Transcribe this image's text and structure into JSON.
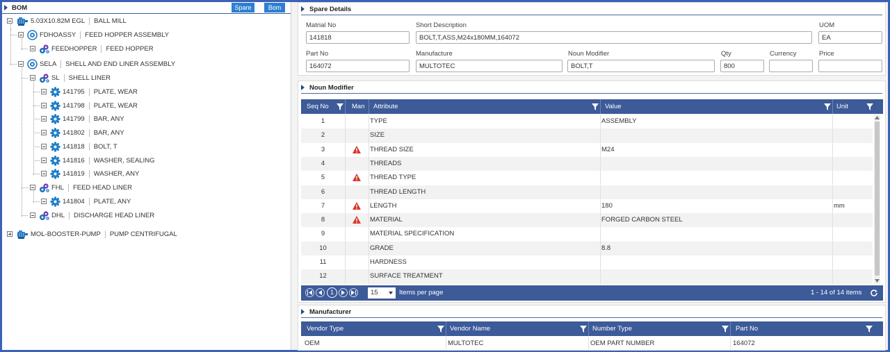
{
  "bom": {
    "title": "BOM",
    "spare_button": "Spare",
    "bom_button": "Bom",
    "nodes": [
      {
        "code": "5.03X10.82M EGL",
        "desc": "BALL MILL",
        "icon": "motor-icon"
      },
      {
        "code": "FDHOASSY",
        "desc": "FEED HOPPER ASSEMBLY",
        "icon": "assembly-icon"
      },
      {
        "code": "FEEDHOPPER",
        "desc": "FEED HOPPER",
        "icon": "gears-icon"
      },
      {
        "code": "SELA",
        "desc": "SHELL AND END LINER ASSEMBLY",
        "icon": "assembly-icon"
      },
      {
        "code": "SL",
        "desc": "SHELL LINER",
        "icon": "gears-icon"
      },
      {
        "code": "141795",
        "desc": "PLATE, WEAR",
        "icon": "gear-icon"
      },
      {
        "code": "141798",
        "desc": "PLATE, WEAR",
        "icon": "gear-icon"
      },
      {
        "code": "141799",
        "desc": "BAR, ANY",
        "icon": "gear-icon"
      },
      {
        "code": "141802",
        "desc": "BAR, ANY",
        "icon": "gear-icon"
      },
      {
        "code": "141818",
        "desc": "BOLT, T",
        "icon": "gear-icon"
      },
      {
        "code": "141816",
        "desc": "WASHER, SEALING",
        "icon": "gear-icon"
      },
      {
        "code": "141819",
        "desc": "WASHER, ANY",
        "icon": "gear-icon"
      },
      {
        "code": "FHL",
        "desc": "FEED HEAD LINER",
        "icon": "gears-icon"
      },
      {
        "code": "141804",
        "desc": "PLATE, ANY",
        "icon": "gear-icon"
      },
      {
        "code": "DHL",
        "desc": "DISCHARGE HEAD LINER",
        "icon": "gears-icon"
      },
      {
        "code": "MOL-BOOSTER-PUMP",
        "desc": "PUMP CENTRIFUGAL",
        "icon": "motor-icon"
      }
    ]
  },
  "spare": {
    "title": "Spare Details",
    "material_no_label": "Matrial No",
    "material_no": "141818",
    "short_desc_label": "Short Description",
    "short_desc": "BOLT,T,ASS,M24x180MM,164072",
    "uom_label": "UOM",
    "uom": "EA",
    "part_no_label": "Part No",
    "part_no": "164072",
    "manufacture_label": "Manufacture",
    "manufacture": "MULTOTEC",
    "noun_modifier_label": "Noun Modifier",
    "noun_modifier": "BOLT,T",
    "qty_label": "Qty",
    "qty": "800",
    "currency_label": "Currency",
    "currency": "",
    "price_label": "Price",
    "price": ""
  },
  "noun": {
    "title": "Noun Modifier",
    "headers": {
      "seq": "Seq No",
      "man": "Man",
      "attribute": "Attribute",
      "value": "Value",
      "unit": "Unit"
    },
    "rows": [
      {
        "seq": "1",
        "man": false,
        "attribute": "TYPE",
        "value": "ASSEMBLY",
        "unit": ""
      },
      {
        "seq": "2",
        "man": false,
        "attribute": "SIZE",
        "value": "",
        "unit": ""
      },
      {
        "seq": "3",
        "man": true,
        "attribute": "THREAD SIZE",
        "value": "M24",
        "unit": ""
      },
      {
        "seq": "4",
        "man": false,
        "attribute": "THREADS",
        "value": "",
        "unit": ""
      },
      {
        "seq": "5",
        "man": true,
        "attribute": "THREAD TYPE",
        "value": "",
        "unit": ""
      },
      {
        "seq": "6",
        "man": false,
        "attribute": "THREAD LENGTH",
        "value": "",
        "unit": ""
      },
      {
        "seq": "7",
        "man": true,
        "attribute": "LENGTH",
        "value": "180",
        "unit": "mm"
      },
      {
        "seq": "8",
        "man": true,
        "attribute": "MATERIAL",
        "value": "FORGED CARBON STEEL",
        "unit": ""
      },
      {
        "seq": "9",
        "man": false,
        "attribute": "MATERIAL SPECIFICATION",
        "value": "",
        "unit": ""
      },
      {
        "seq": "10",
        "man": false,
        "attribute": "GRADE",
        "value": "8.8",
        "unit": ""
      },
      {
        "seq": "11",
        "man": false,
        "attribute": "HARDNESS",
        "value": "",
        "unit": ""
      },
      {
        "seq": "12",
        "man": false,
        "attribute": "SURFACE TREATMENT",
        "value": "",
        "unit": ""
      }
    ],
    "pager": {
      "current_page": "1",
      "page_size": "15",
      "items_per_page": "Items per page",
      "summary": "1 - 14 of 14 items"
    }
  },
  "manufacturer": {
    "title": "Manufacturer",
    "headers": {
      "vendor_type": "Vendor Type",
      "vendor_name": "Vendor Name",
      "number_type": "Number Type",
      "part_no": "Part No"
    },
    "rows": [
      {
        "vendor_type": "OEM",
        "vendor_name": "MULTOTEC",
        "number_type": "OEM PART NUMBER",
        "part_no": "164072"
      }
    ]
  },
  "colors": {
    "frame": "#3a63b8",
    "grid_header": "#3d5a99",
    "button_blue": "#2e7fd1",
    "warning_red": "#d9342b"
  }
}
